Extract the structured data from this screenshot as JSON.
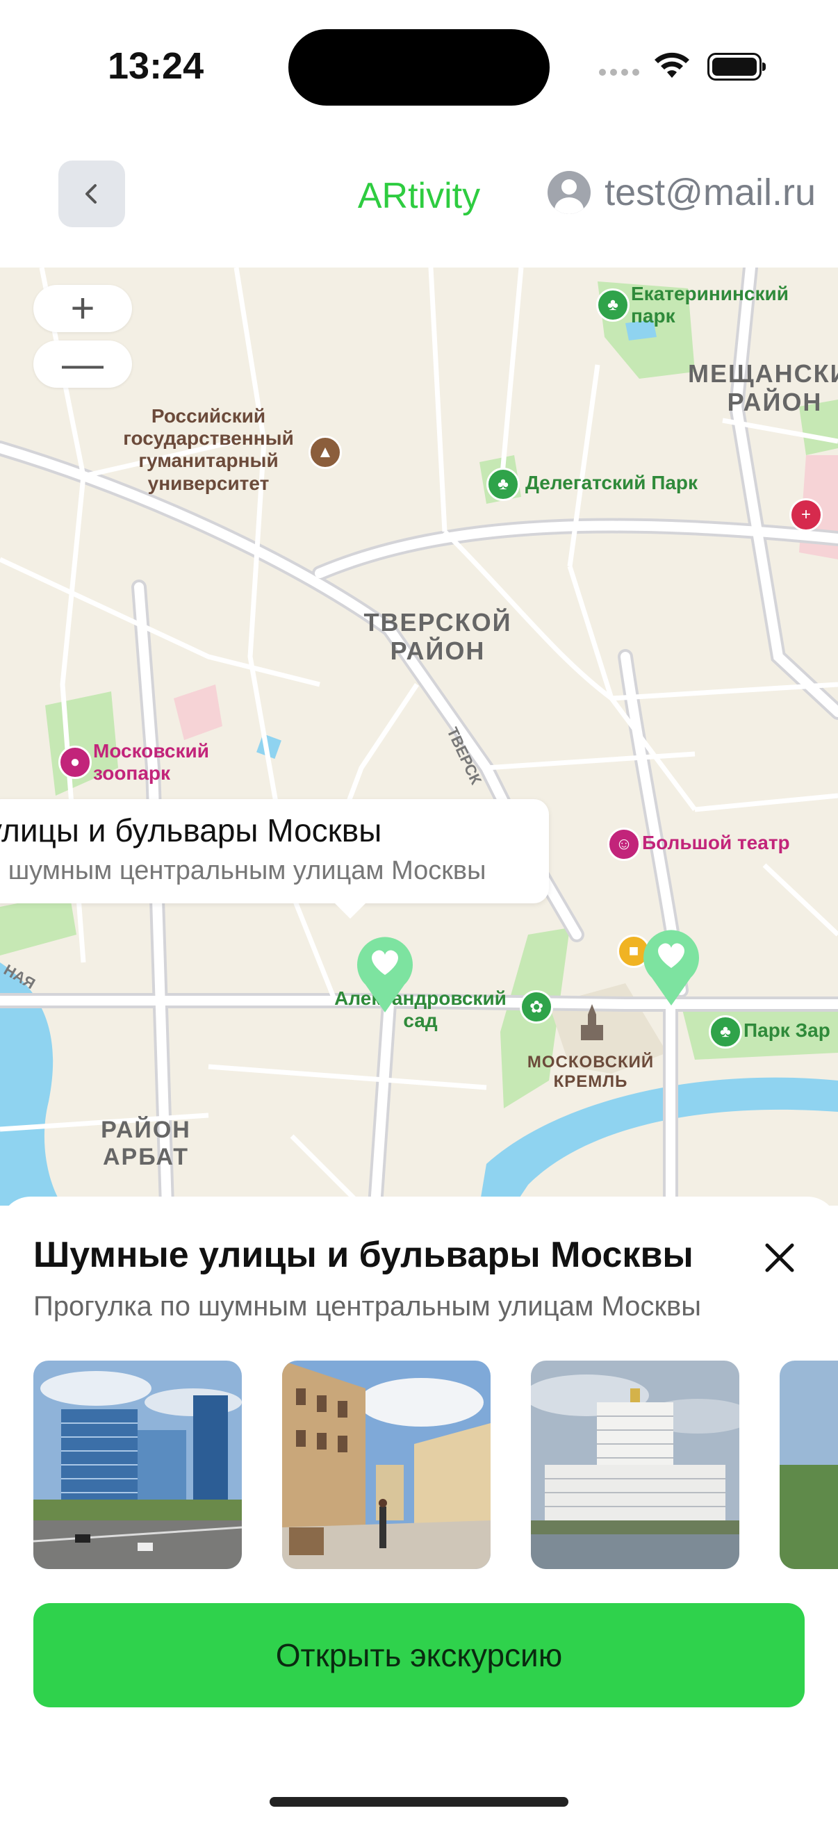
{
  "status_bar": {
    "time": "13:24"
  },
  "header": {
    "title": "ARtivity",
    "user_email": "test@mail.ru",
    "back_icon": "chevron-left-icon",
    "avatar_icon": "user-avatar-icon"
  },
  "map": {
    "zoom_in": "+",
    "zoom_out": "—",
    "labels": {
      "ekaterininsky": "Екатерининский парк",
      "meshchansky": "МЕЩАНСКИЙ РАЙОН",
      "rggu": "Российский государственный гуманитарный университет",
      "delegatsky": "Делегатский Парк",
      "tverskoy": "ТВЕРСКОЙ РАЙОН",
      "zoo": "Московский зоопарк",
      "bolshoi": "Большой театр",
      "alexandrovsky": "Александровский сад",
      "kremlin": "МОСКОВСКИЙ КРЕМЛЬ",
      "park_zaryadye": "Парк Зар",
      "arbat": "РАЙОН АРБАТ",
      "tverskaya": "ТВЕРСК",
      "naya": "НАЯ"
    },
    "tooltip": {
      "title": "улицы и бульвары Москвы",
      "subtitle": "о шумным центральным улицам Москвы"
    },
    "pin_icon": "heart-pin-icon",
    "colors": {
      "pin": "#7de3a0",
      "park": "#c6e8b4",
      "water": "#8fd3f0",
      "road": "#ffffff"
    }
  },
  "sheet": {
    "title": "Шумные улицы и бульвары Москвы",
    "subtitle": "Прогулка по шумным центральным улицам Москвы",
    "close_icon": "close-icon",
    "photos": [
      "photo-business-center",
      "photo-arbat-street",
      "photo-white-house",
      "photo-partial"
    ],
    "open_button": "Открыть экскурсию",
    "accent": "#2fd24c"
  }
}
